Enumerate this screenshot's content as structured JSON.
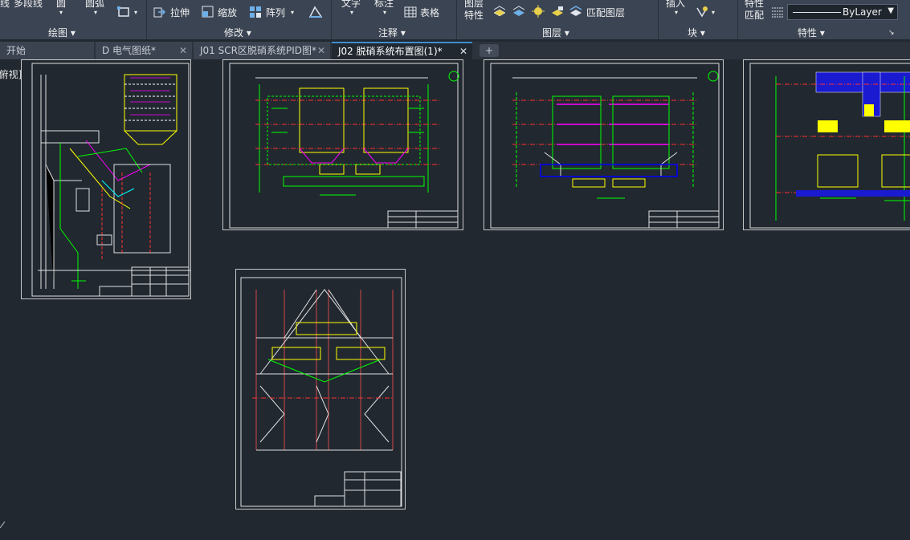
{
  "ribbon": {
    "draw": {
      "polyline": "多段线",
      "circle": "圆",
      "arc": "圆弧",
      "line_cut": "线"
    },
    "modify": {
      "stretch": "拉伸",
      "scale": "缩放",
      "array": "阵列"
    },
    "annotate": {
      "text": "文字",
      "dimension": "标注",
      "table": "表格"
    },
    "layers": {
      "layer_props": "图层",
      "layer_props2": "特性",
      "match_layer": "匹配图层"
    },
    "block": {
      "insert": "插入"
    },
    "properties": {
      "match": "特性",
      "match2": "匹配",
      "bylayer": "ByLayer"
    },
    "panels": {
      "draw": "绘图",
      "modify": "修改",
      "annotate": "注释",
      "layers": "图层",
      "block": "块",
      "properties": "特性"
    }
  },
  "tabs": [
    {
      "label": "开始"
    },
    {
      "label": "D 电气图纸*"
    },
    {
      "label": "J01 SCR区脱硝系统PID图*"
    },
    {
      "label": "J02 脱硝系统布置图(1)*"
    }
  ],
  "viewport": {
    "label": "[俯视][二维线框]"
  },
  "colors": {
    "ribbon_bg": "#3b4453",
    "canvas_bg": "#212830",
    "accent": "#3d8fd0",
    "cad_green": "#00ff00",
    "cad_yellow": "#ffff00",
    "cad_magenta": "#ff00ff",
    "cad_blue": "#0000ff",
    "cad_red": "#ff3030",
    "cad_white": "#ffffff"
  }
}
